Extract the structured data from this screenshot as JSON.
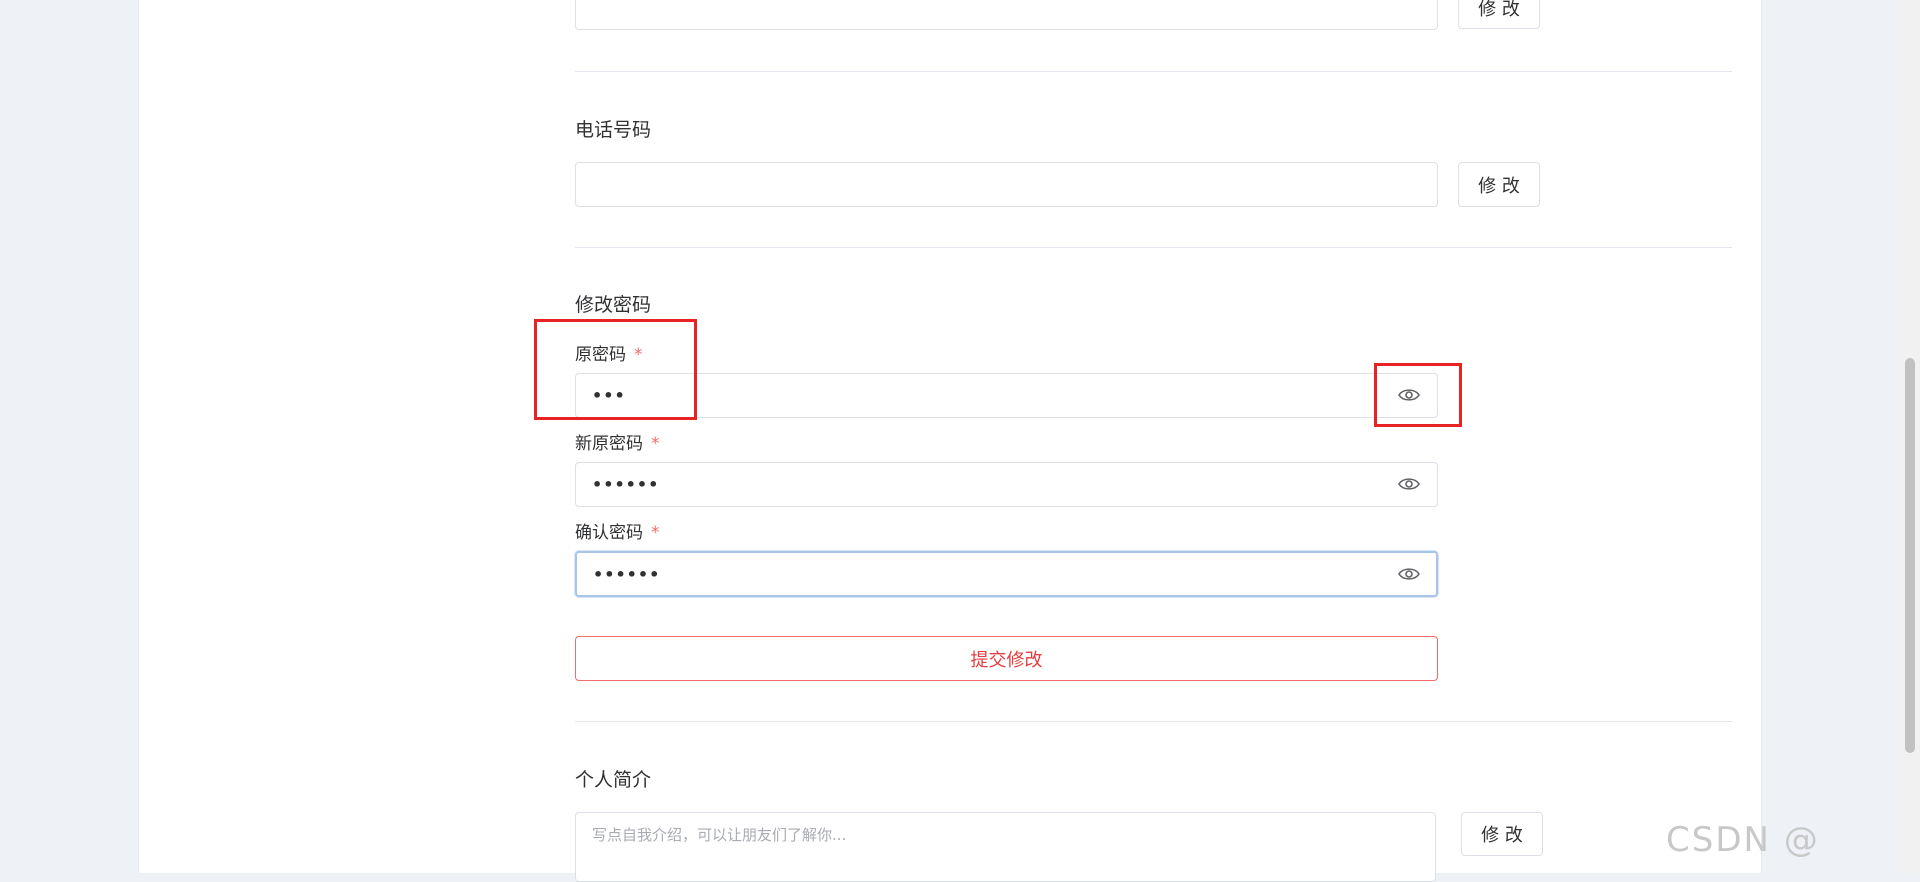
{
  "sections": {
    "top_field": {
      "value": "",
      "edit_label": "修 改"
    },
    "phone": {
      "title": "电话号码",
      "value": "",
      "edit_label": "修 改"
    },
    "password": {
      "title": "修改密码",
      "old": {
        "label": "原密码",
        "required_mark": "*",
        "value": "•••"
      },
      "new": {
        "label": "新原密码",
        "required_mark": "*",
        "value": "••••••"
      },
      "confirm": {
        "label": "确认密码",
        "required_mark": "*",
        "value": "••••••"
      },
      "submit_label": "提交修改"
    },
    "bio": {
      "title": "个人简介",
      "placeholder": "写点自我介绍，可以让朋友们了解你...",
      "edit_label": "修 改"
    }
  },
  "watermark": "CSDN @",
  "icons": {
    "eye": "eye-icon"
  },
  "colors": {
    "required": "#f56c6c",
    "submit": "#e43d3d",
    "annotation": "#e82323",
    "focus": "#a9c6e8"
  }
}
